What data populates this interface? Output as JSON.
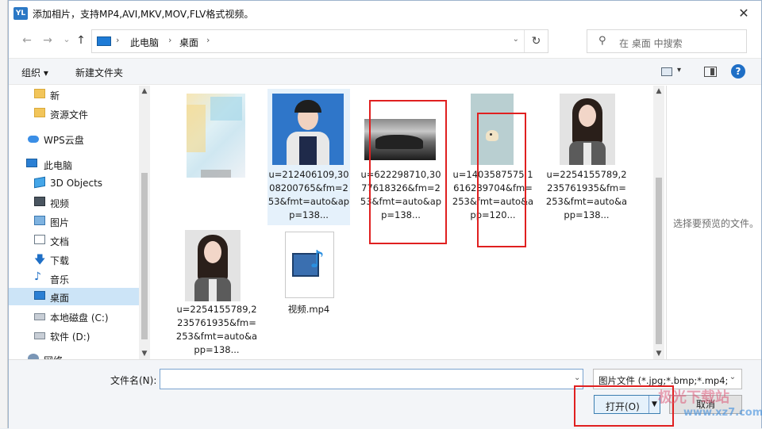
{
  "window": {
    "app_icon": "YL",
    "title": "添加相片，支持MP4,AVI,MKV,MOV,FLV格式视频。",
    "close_glyph": "✕"
  },
  "nav": {
    "back_glyph": "←",
    "forward_glyph": "→",
    "recent_glyph": "⌄",
    "up_glyph": "↑",
    "breadcrumb": [
      "此电脑",
      "桌面"
    ],
    "refresh_glyph": "↻",
    "search_placeholder": "在 桌面 中搜索"
  },
  "toolbar": {
    "organize": "组织 ▾",
    "new_folder": "新建文件夹",
    "help_glyph": "?"
  },
  "sidebar": {
    "items": [
      {
        "label": "新",
        "icon": "folder-icon"
      },
      {
        "label": "资源文件",
        "icon": "folder-icon"
      },
      {
        "label": "WPS云盘",
        "icon": "cloud-icon"
      },
      {
        "label": "此电脑",
        "icon": "computer-icon"
      },
      {
        "label": "3D Objects",
        "icon": "3d-objects-icon"
      },
      {
        "label": "视频",
        "icon": "videos-icon"
      },
      {
        "label": "图片",
        "icon": "pictures-icon"
      },
      {
        "label": "文档",
        "icon": "documents-icon"
      },
      {
        "label": "下载",
        "icon": "downloads-icon"
      },
      {
        "label": "音乐",
        "icon": "music-icon"
      },
      {
        "label": "桌面",
        "icon": "desktop-icon",
        "selected": true
      },
      {
        "label": "本地磁盘 (C:)",
        "icon": "drive-icon"
      },
      {
        "label": "软件 (D:)",
        "icon": "drive-icon"
      },
      {
        "label": "网络",
        "icon": "network-icon"
      }
    ]
  },
  "files": [
    {
      "name": "",
      "kind": "blurred-image"
    },
    {
      "name": "u=212406109,3008200765&fm=253&fmt=auto&app=138...",
      "kind": "portrait-blue"
    },
    {
      "name": "u=622298710,3077618326&fm=253&fmt=auto&app=138...",
      "kind": "landscape-bw"
    },
    {
      "name": "u=1403587575,1616289704&fm=253&fmt=auto&app=120...",
      "kind": "small-cartoon"
    },
    {
      "name": "u=2254155789,2235761935&fm=253&fmt=auto&app=138...",
      "kind": "portrait-grey"
    },
    {
      "name": "u=2254155789,2235761935&fm=253&fmt=auto&app=138...",
      "kind": "portrait-grey"
    },
    {
      "name": "视频.mp4",
      "kind": "video-file"
    }
  ],
  "preview": {
    "empty_text": "选择要预览的文件。"
  },
  "bottom": {
    "filename_label": "文件名(N):",
    "filename_value": "",
    "filetype": "图片文件 (*.jpg;*.bmp;*.mp4;",
    "open_label": "打开(O)",
    "cancel_label": "取消"
  },
  "watermark": {
    "line1": "极光下载站",
    "line2": "www.xz7.com"
  },
  "colors": {
    "selection": "#cce4f7",
    "annotation_red": "#e02020",
    "accent_blue": "#1f6fc6"
  }
}
